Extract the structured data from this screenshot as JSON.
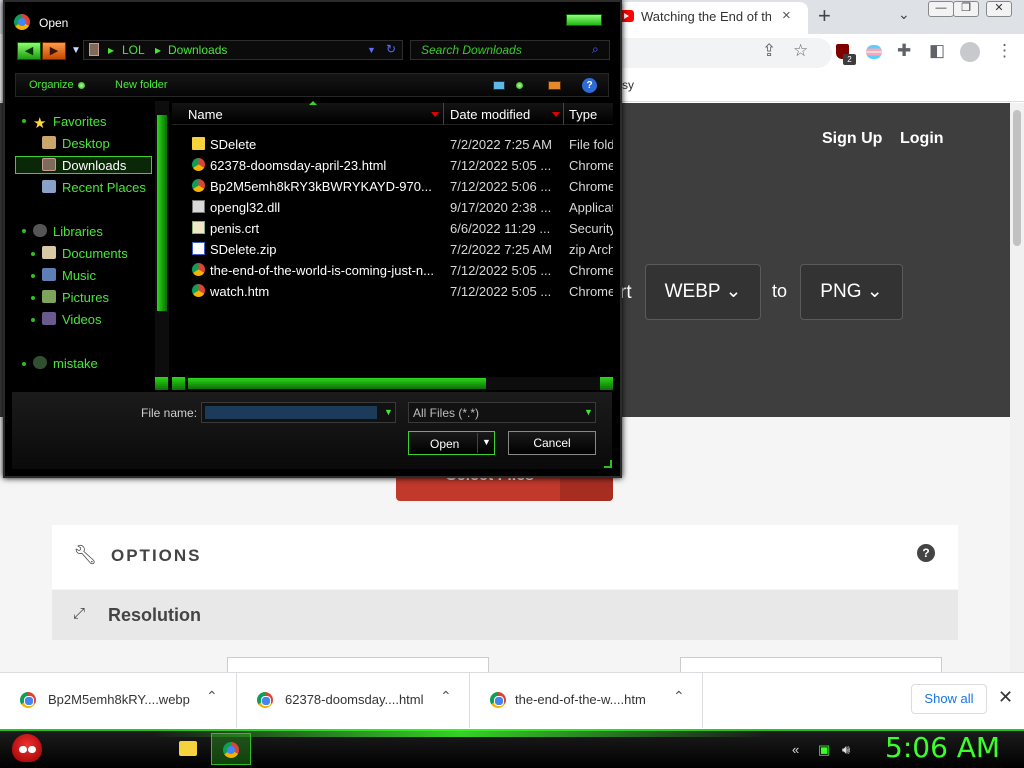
{
  "browser": {
    "tab_title": "Watching the End of the",
    "tab_close": "×",
    "new_tab": "+",
    "tab_search": "⌄",
    "window_controls": [
      "—",
      "❐",
      "✕"
    ],
    "bookmark_partial": "sy",
    "ext_badge": "2"
  },
  "page": {
    "nav_signup": "Sign Up",
    "nav_login": "Login",
    "convert_label": "rt",
    "from_format": "WEBP",
    "to_label": "to",
    "to_format": "PNG",
    "select_files_label": "Select Files",
    "options_title": "OPTIONS",
    "help_icon": "?",
    "resolution_title": "Resolution",
    "colors": {
      "hero_bg": "#3e3e3e",
      "select_btn": "#c0392b"
    }
  },
  "downloads": {
    "items": [
      {
        "name": "Bp2M5emh8kRY....webp"
      },
      {
        "name": "62378-doomsday....html"
      },
      {
        "name": "the-end-of-the-w....htm"
      }
    ],
    "show_all": "Show all",
    "close": "✕"
  },
  "taskbar": {
    "clock": "5:06 AM",
    "accent": "#3cff2a"
  },
  "dialog": {
    "title": "Open",
    "breadcrumb": [
      "LOL",
      "Downloads"
    ],
    "search_placeholder": "Search Downloads",
    "toolbar": {
      "organize": "Organize",
      "new_folder": "New folder",
      "help": "?"
    },
    "nav": {
      "favorites": "Favorites",
      "desktop": "Desktop",
      "downloads": "Downloads",
      "recent_places": "Recent Places",
      "libraries": "Libraries",
      "documents": "Documents",
      "music": "Music",
      "pictures": "Pictures",
      "videos": "Videos",
      "mistake": "mistake"
    },
    "columns": {
      "name": "Name",
      "date_modified": "Date modified",
      "type": "Type"
    },
    "files": [
      {
        "icon": "folder-icon",
        "name": "SDelete",
        "date": "7/2/2022 7:25 AM",
        "type": "File folder"
      },
      {
        "icon": "chrome-html-icon",
        "name": "62378-doomsday-april-23.html",
        "date": "7/12/2022 5:05 ...",
        "type": "Chrome"
      },
      {
        "icon": "chrome-html-icon",
        "name": "Bp2M5emh8kRY3kBWRYKAYD-970...",
        "date": "7/12/2022 5:06 ...",
        "type": "Chrome"
      },
      {
        "icon": "dll-icon",
        "name": "opengl32.dll",
        "date": "9/17/2020 2:38 ...",
        "type": "Application"
      },
      {
        "icon": "certificate-icon",
        "name": "penis.crt",
        "date": "6/6/2022 11:29 ...",
        "type": "Security"
      },
      {
        "icon": "zip-icon",
        "name": "SDelete.zip",
        "date": "7/2/2022 7:25 AM",
        "type": "zip Archive"
      },
      {
        "icon": "chrome-html-icon",
        "name": "the-end-of-the-world-is-coming-just-n...",
        "date": "7/12/2022 5:05 ...",
        "type": "Chrome"
      },
      {
        "icon": "chrome-html-icon",
        "name": "watch.htm",
        "date": "7/12/2022 5:05 ...",
        "type": "Chrome"
      }
    ],
    "file_name_label": "File name:",
    "file_name_value": "",
    "filter_value": "All Files (*.*)",
    "open_label": "Open",
    "cancel_label": "Cancel",
    "accent": "#49e63a"
  }
}
